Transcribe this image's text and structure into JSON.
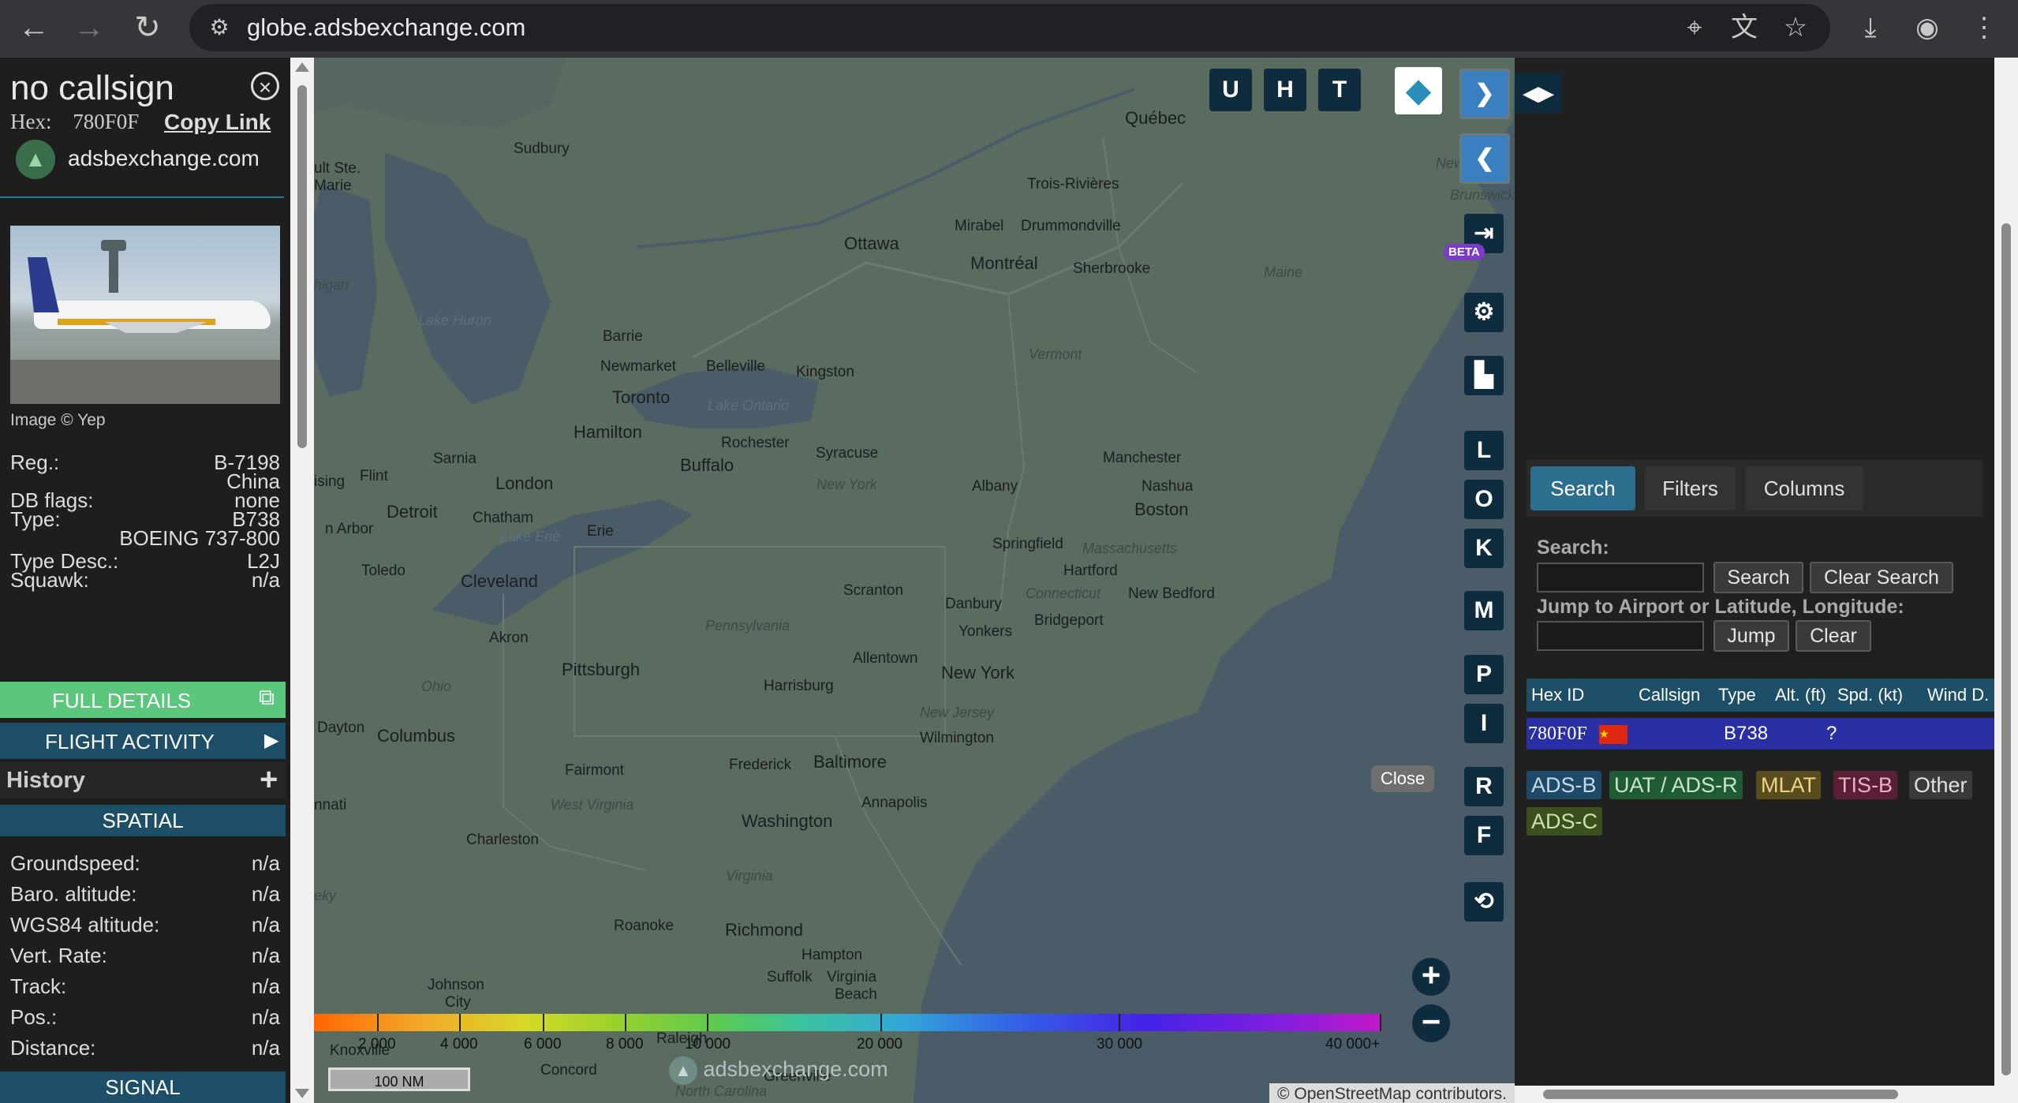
{
  "browser": {
    "url": "globe.adsbexchange.com"
  },
  "aircraft": {
    "callsign": "no callsign",
    "hex_label": "Hex:",
    "hex": "780F0F",
    "copy_link": "Copy Link",
    "site": "adsbexchange.com",
    "image_credit": "Image © Yep",
    "fields": [
      {
        "label": "Reg.:",
        "value": "B-7198"
      },
      {
        "label": "",
        "value": "China"
      },
      {
        "label": "DB flags:",
        "value": "none"
      },
      {
        "label": "Type:",
        "value": "B738"
      },
      {
        "label": "",
        "value": "BOEING 737-800"
      },
      {
        "label": "Type Desc.:",
        "value": "L2J"
      },
      {
        "label": "Squawk:",
        "value": "n/a"
      }
    ],
    "full_details": "FULL DETAILS",
    "flight_activity": "FLIGHT ACTIVITY",
    "history": "History",
    "spatial": "SPATIAL",
    "spatial_fields": [
      {
        "label": "Groundspeed:",
        "value": "n/a"
      },
      {
        "label": "Baro. altitude:",
        "value": "n/a"
      },
      {
        "label": "WGS84 altitude:",
        "value": "n/a"
      },
      {
        "label": "Vert. Rate:",
        "value": "n/a"
      },
      {
        "label": "Track:",
        "value": "n/a"
      },
      {
        "label": "Pos.:",
        "value": "n/a"
      },
      {
        "label": "Distance:",
        "value": "n/a"
      }
    ],
    "signal": "SIGNAL"
  },
  "map": {
    "top_buttons": [
      "U",
      "H",
      "T"
    ],
    "side_buttons": [
      "L",
      "O",
      "K",
      "M",
      "P",
      "I",
      "R",
      "F"
    ],
    "beta": "BETA",
    "close": "Close",
    "scale": "100 NM",
    "watermark": "adsbexchange.com",
    "attribution": "© OpenStreetMap contributors.",
    "altitude_labels": [
      "2 000",
      "4 000",
      "6 000",
      "8 000",
      "10 000",
      "20 000",
      "30 000",
      "40 000+"
    ],
    "places": [
      {
        "name": "Québec",
        "cls": "big"
      },
      {
        "name": "Sudbury",
        "cls": ""
      },
      {
        "name": "ult Ste.",
        "cls": ""
      },
      {
        "name": "Marie",
        "cls": ""
      },
      {
        "name": "Trois-Rivières",
        "cls": ""
      },
      {
        "name": "Ottawa",
        "cls": "big"
      },
      {
        "name": "Mirabel",
        "cls": ""
      },
      {
        "name": "Drummondville",
        "cls": ""
      },
      {
        "name": "Montréal",
        "cls": "big"
      },
      {
        "name": "Sherbrooke",
        "cls": ""
      },
      {
        "name": "Maine",
        "cls": "state"
      },
      {
        "name": "New",
        "cls": "state"
      },
      {
        "name": "Brunswick",
        "cls": "state"
      },
      {
        "name": "higan",
        "cls": "state"
      },
      {
        "name": "Lake Huron",
        "cls": "water"
      },
      {
        "name": "Barrie",
        "cls": ""
      },
      {
        "name": "Newmarket",
        "cls": ""
      },
      {
        "name": "Belleville",
        "cls": ""
      },
      {
        "name": "Kingston",
        "cls": ""
      },
      {
        "name": "Vermont",
        "cls": "state"
      },
      {
        "name": "Toronto",
        "cls": "big"
      },
      {
        "name": "Lake Ontario",
        "cls": "water"
      },
      {
        "name": "Hamilton",
        "cls": "big"
      },
      {
        "name": "Rochester",
        "cls": ""
      },
      {
        "name": "Syracuse",
        "cls": ""
      },
      {
        "name": "Manchester",
        "cls": ""
      },
      {
        "name": "Nashua",
        "cls": ""
      },
      {
        "name": "Sarnia",
        "cls": ""
      },
      {
        "name": "Flint",
        "cls": ""
      },
      {
        "name": "Buffalo",
        "cls": "big"
      },
      {
        "name": "New York",
        "cls": "state"
      },
      {
        "name": "Albany",
        "cls": ""
      },
      {
        "name": "Boston",
        "cls": "big"
      },
      {
        "name": "London",
        "cls": "big"
      },
      {
        "name": "ising",
        "cls": ""
      },
      {
        "name": "Detroit",
        "cls": "big"
      },
      {
        "name": "Chatham",
        "cls": ""
      },
      {
        "name": "Erie",
        "cls": ""
      },
      {
        "name": "Lake Erie",
        "cls": "water"
      },
      {
        "name": "n Arbor",
        "cls": ""
      },
      {
        "name": "Springfield",
        "cls": ""
      },
      {
        "name": "Massachusetts",
        "cls": "state"
      },
      {
        "name": "Toledo",
        "cls": ""
      },
      {
        "name": "Hartford",
        "cls": ""
      },
      {
        "name": "Cleveland",
        "cls": "big"
      },
      {
        "name": "Connecticut",
        "cls": "state"
      },
      {
        "name": "New Bedford",
        "cls": ""
      },
      {
        "name": "Scranton",
        "cls": ""
      },
      {
        "name": "Danbury",
        "cls": ""
      },
      {
        "name": "Pennsylvania",
        "cls": "state"
      },
      {
        "name": "Akron",
        "cls": ""
      },
      {
        "name": "Yonkers",
        "cls": ""
      },
      {
        "name": "Bridgeport",
        "cls": ""
      },
      {
        "name": "Allentown",
        "cls": ""
      },
      {
        "name": "Pittsburgh",
        "cls": "big"
      },
      {
        "name": "Ohio",
        "cls": "state"
      },
      {
        "name": "New York",
        "cls": "big"
      },
      {
        "name": "Harrisburg",
        "cls": ""
      },
      {
        "name": "New Jersey",
        "cls": "state"
      },
      {
        "name": "Dayton",
        "cls": ""
      },
      {
        "name": "Columbus",
        "cls": "big"
      },
      {
        "name": "Wilmington",
        "cls": ""
      },
      {
        "name": "Baltimore",
        "cls": "big"
      },
      {
        "name": "Frederick",
        "cls": ""
      },
      {
        "name": "Fairmont",
        "cls": ""
      },
      {
        "name": "Annapolis",
        "cls": ""
      },
      {
        "name": "West Virginia",
        "cls": "state"
      },
      {
        "name": "Washington",
        "cls": "big"
      },
      {
        "name": "nnati",
        "cls": ""
      },
      {
        "name": "Charleston",
        "cls": ""
      },
      {
        "name": "Virginia",
        "cls": "state"
      },
      {
        "name": "Roanoke",
        "cls": ""
      },
      {
        "name": "Richmond",
        "cls": "big"
      },
      {
        "name": "Hampton",
        "cls": ""
      },
      {
        "name": "Suffolk",
        "cls": ""
      },
      {
        "name": "Virginia",
        "cls": ""
      },
      {
        "name": "Beach",
        "cls": ""
      },
      {
        "name": "Johnson",
        "cls": ""
      },
      {
        "name": "City",
        "cls": ""
      },
      {
        "name": "Knoxville",
        "cls": ""
      },
      {
        "name": "Raleigh",
        "cls": ""
      },
      {
        "name": "Concord",
        "cls": ""
      },
      {
        "name": "Greenville",
        "cls": ""
      },
      {
        "name": "North Carolina",
        "cls": "state"
      },
      {
        "name": "eky",
        "cls": "state"
      }
    ]
  },
  "panel": {
    "tabs": [
      "Search",
      "Filters",
      "Columns"
    ],
    "search_label": "Search:",
    "search_button": "Search",
    "clear_search_button": "Clear Search",
    "jump_label": "Jump to Airport or Latitude, Longitude:",
    "jump_button": "Jump",
    "clear_button": "Clear",
    "columns": [
      "Hex ID",
      "Callsign",
      "Type",
      "Alt. (ft)",
      "Spd. (kt)",
      "Wind D."
    ],
    "row": {
      "hex": "780F0F",
      "callsign": "",
      "type": "B738",
      "alt": "?",
      "spd": "",
      "wind": ""
    },
    "legend": [
      {
        "label": "ADS-B",
        "bg": "#1e4a6a",
        "fg": "#c9d8e6"
      },
      {
        "label": "UAT / ADS-R",
        "bg": "#1f5c35",
        "fg": "#c7e6c4"
      },
      {
        "label": "MLAT",
        "bg": "#5a4d1d",
        "fg": "#ecd58a"
      },
      {
        "label": "TIS-B",
        "bg": "#5a1f37",
        "fg": "#eab0c6"
      },
      {
        "label": "Other",
        "bg": "#3a3a3a",
        "fg": "#e0e0e0"
      },
      {
        "label": "ADS-C",
        "bg": "#3c4f1f",
        "fg": "#cfe0a8"
      }
    ]
  },
  "colors": {
    "accent": "#2c6e8e",
    "full_details": "#5bc77d",
    "section": "#1e4f68",
    "selected_row": "#2a2fa6"
  }
}
